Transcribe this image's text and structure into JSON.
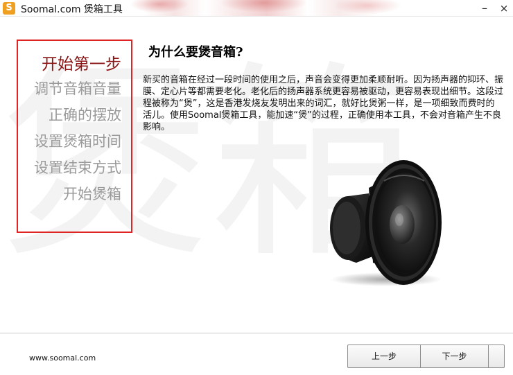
{
  "window": {
    "title": "Soomal.com 煲箱工具",
    "logo_glyph": "S",
    "minimize_label": "–",
    "close_label": "×"
  },
  "sidebar": {
    "watermark": "煲箱",
    "steps": [
      {
        "label": "开始第一步",
        "active": true
      },
      {
        "label": "调节音箱音量",
        "active": false
      },
      {
        "label": "正确的摆放",
        "active": false
      },
      {
        "label": "设置煲箱时间",
        "active": false
      },
      {
        "label": "设置结束方式",
        "active": false
      },
      {
        "label": "开始煲箱",
        "active": false
      }
    ]
  },
  "main": {
    "heading": "为什么要煲音箱?",
    "body": "新买的音箱在经过一段时间的使用之后，声音会变得更加柔顺耐听。因为扬声器的抑环、振膜、定心片等都需要老化。老化后的扬声器系统更容易被驱动，更容易表现出细节。这段过程被称为“煲”，这是香港发烧友发明出来的词汇，就好比煲粥一样，是一项细致而费时的活儿。使用Soomal煲箱工具，能加速“煲”的过程，正确使用本工具，不会对音箱产生不良影响。",
    "image_icon": "speaker-woofer"
  },
  "footer": {
    "url": "www.soomal.com",
    "prev_label": "上一步",
    "next_label": "下一步"
  },
  "colors": {
    "accent_red": "#e02424",
    "active_step": "#8b1414",
    "inactive_step": "#9a9a9a"
  }
}
